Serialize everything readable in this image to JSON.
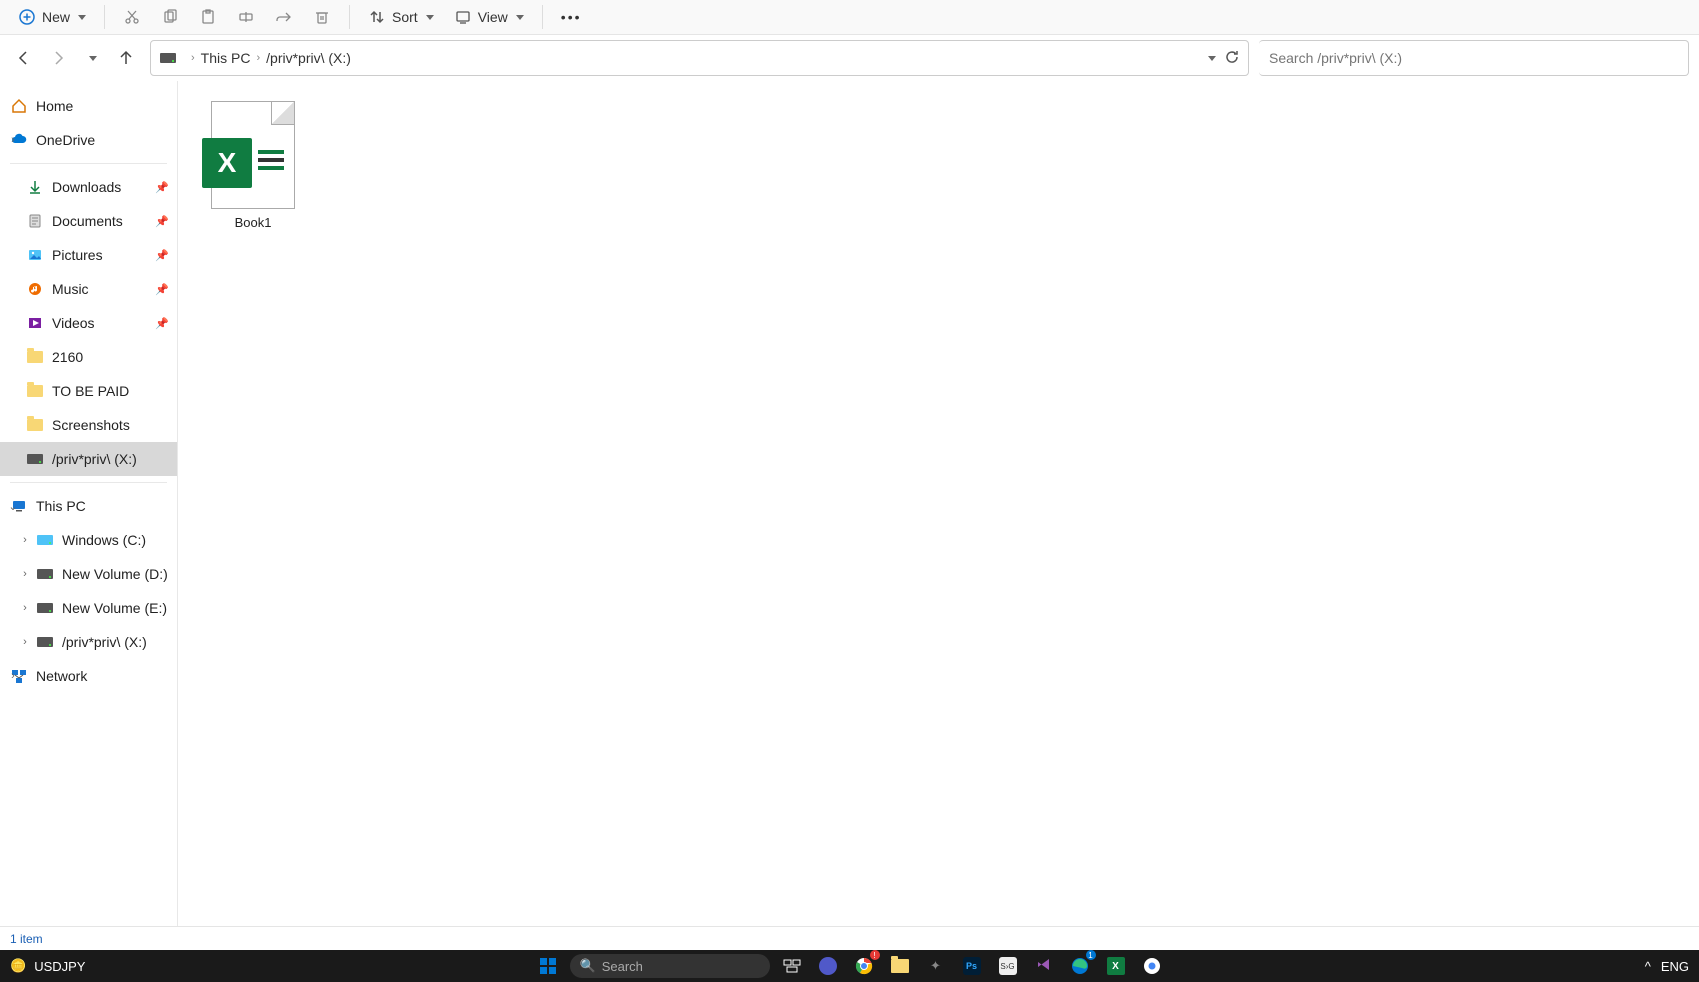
{
  "toolbar": {
    "new_label": "New",
    "sort_label": "Sort",
    "view_label": "View"
  },
  "breadcrumb": {
    "root": "This PC",
    "current": "/priv*priv\\ (X:)"
  },
  "search": {
    "placeholder": "Search /priv*priv\\ (X:)"
  },
  "sidebar": {
    "home": "Home",
    "onedrive": "OneDrive",
    "quick": [
      {
        "label": "Downloads",
        "pinned": true,
        "icon": "download"
      },
      {
        "label": "Documents",
        "pinned": true,
        "icon": "document"
      },
      {
        "label": "Pictures",
        "pinned": true,
        "icon": "pictures"
      },
      {
        "label": "Music",
        "pinned": true,
        "icon": "music"
      },
      {
        "label": "Videos",
        "pinned": true,
        "icon": "videos"
      },
      {
        "label": "2160",
        "pinned": false,
        "icon": "folder"
      },
      {
        "label": "TO BE PAID",
        "pinned": false,
        "icon": "folder"
      },
      {
        "label": "Screenshots",
        "pinned": false,
        "icon": "folder"
      },
      {
        "label": "/priv*priv\\ (X:)",
        "pinned": false,
        "icon": "drive",
        "active": true
      }
    ],
    "thispc": "This PC",
    "drives": [
      {
        "label": "Windows (C:)"
      },
      {
        "label": "New Volume (D:)"
      },
      {
        "label": "New Volume (E:)"
      },
      {
        "label": "/priv*priv\\ (X:)"
      }
    ],
    "network": "Network"
  },
  "files": [
    {
      "name": "Book1",
      "type": "excel"
    }
  ],
  "status": {
    "text": "1 item"
  },
  "taskbar": {
    "widget": "USDJPY",
    "search_placeholder": "Search",
    "lang": "ENG"
  }
}
